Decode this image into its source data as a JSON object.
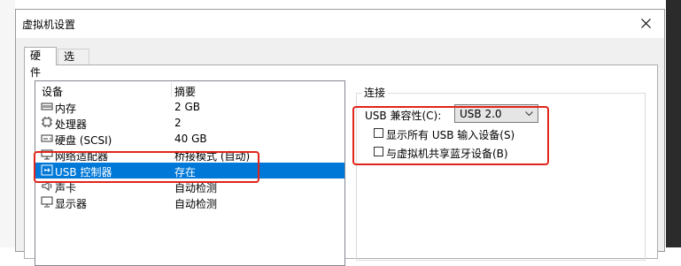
{
  "dialog": {
    "title": "虚拟机设置"
  },
  "tabs": [
    {
      "label": "硬件",
      "active": true
    },
    {
      "label": "选项",
      "active": false
    }
  ],
  "device_list": {
    "columns": {
      "device": "设备",
      "summary": "摘要"
    },
    "rows": [
      {
        "device": "内存",
        "summary": "2 GB",
        "icon": "memory-icon"
      },
      {
        "device": "处理器",
        "summary": "2",
        "icon": "cpu-icon"
      },
      {
        "device": "硬盘 (SCSI)",
        "summary": "40 GB",
        "icon": "harddisk-icon"
      },
      {
        "device": "网络适配器",
        "summary": "桥接模式 (自动)",
        "icon": "network-adapter-icon"
      },
      {
        "device": "USB 控制器",
        "summary": "存在",
        "icon": "usb-controller-icon",
        "selected": true
      },
      {
        "device": "声卡",
        "summary": "自动检测",
        "icon": "sound-card-icon"
      },
      {
        "device": "显示器",
        "summary": "自动检测",
        "icon": "display-icon"
      }
    ]
  },
  "connection": {
    "group_title": "连接",
    "compat_label": "USB 兼容性(C):",
    "compat_value": "USB 2.0",
    "show_all_input": {
      "label": "显示所有 USB 输入设备(S)",
      "checked": false
    },
    "share_bluetooth": {
      "label": "与虚拟机共享蓝牙设备(B)",
      "checked": false
    }
  },
  "colors": {
    "selection": "#0078d7",
    "annotation": "#e0241c"
  }
}
